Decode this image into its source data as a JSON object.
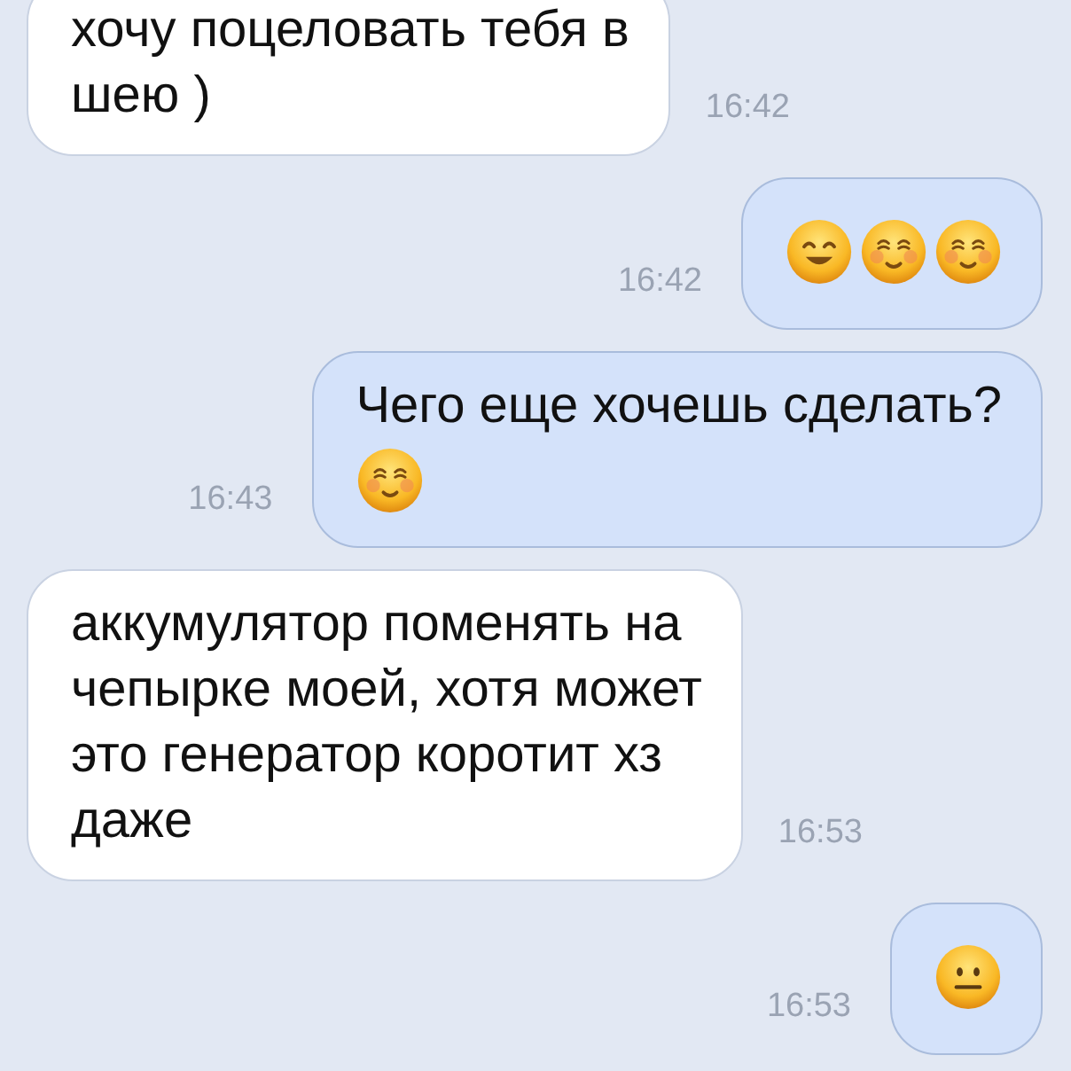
{
  "messages": [
    {
      "kind": "incoming",
      "text": "хочу поцеловать тебя в\nшею )",
      "time": "16:42"
    },
    {
      "kind": "outgoing",
      "emojis": [
        {
          "kind": "smiling"
        },
        {
          "kind": "blushing"
        },
        {
          "kind": "blushing"
        }
      ],
      "time": "16:42"
    },
    {
      "kind": "outgoing",
      "text": "Чего еще хочешь сделать?",
      "emojis": [
        {
          "kind": "blushing"
        }
      ],
      "time": "16:43"
    },
    {
      "kind": "incoming",
      "text": "аккумулятор поменять на\nчепырке моей, хотя может\nэто генератор коротит хз\nдаже",
      "time": "16:53"
    },
    {
      "kind": "outgoing",
      "emojis": [
        {
          "kind": "neutral"
        }
      ],
      "time": "16:53"
    }
  ]
}
